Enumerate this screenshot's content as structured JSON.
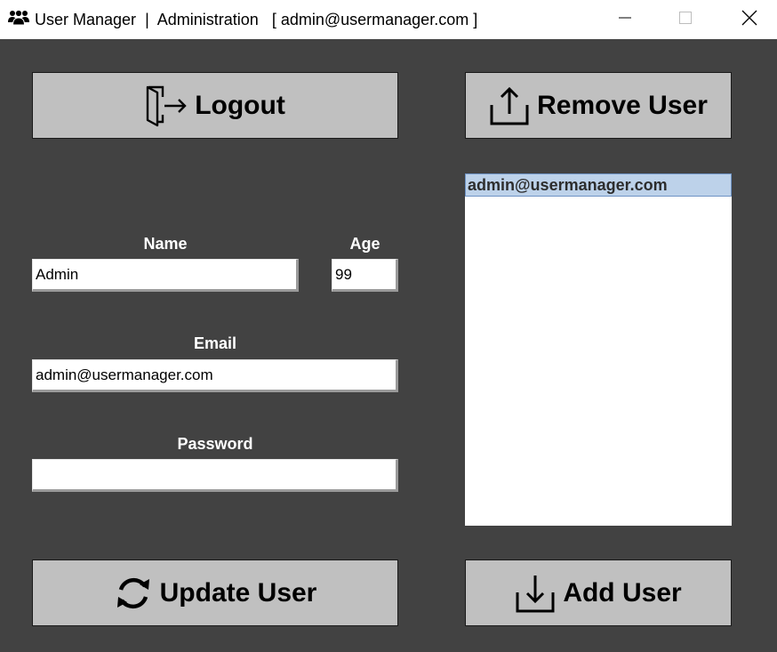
{
  "window": {
    "app_name": "User Manager",
    "separator": "|",
    "section": "Administration",
    "account": "[ admin@usermanager.com ]",
    "icon": "users-icon",
    "controls": [
      "minimize-icon",
      "maximize-icon",
      "close-icon"
    ]
  },
  "buttons": {
    "logout": {
      "label": "Logout",
      "icon": "logout-door-icon"
    },
    "remove_user": {
      "label": "Remove User",
      "icon": "upload-icon"
    },
    "update_user": {
      "label": "Update User",
      "icon": "refresh-icon"
    },
    "add_user": {
      "label": "Add User",
      "icon": "download-icon"
    }
  },
  "form": {
    "name": {
      "label": "Name",
      "value": "Admin"
    },
    "age": {
      "label": "Age",
      "value": "99"
    },
    "email": {
      "label": "Email",
      "value": "admin@usermanager.com"
    },
    "password": {
      "label": "Password",
      "value": ""
    }
  },
  "user_list": {
    "items": [
      {
        "label": "admin@usermanager.com",
        "selected": true
      }
    ]
  },
  "colors": {
    "background": "#424242",
    "button": "#c0c0c0",
    "selection": "#bdd2ea",
    "selection_border": "#6e93c5",
    "label_text": "#ffffff"
  }
}
